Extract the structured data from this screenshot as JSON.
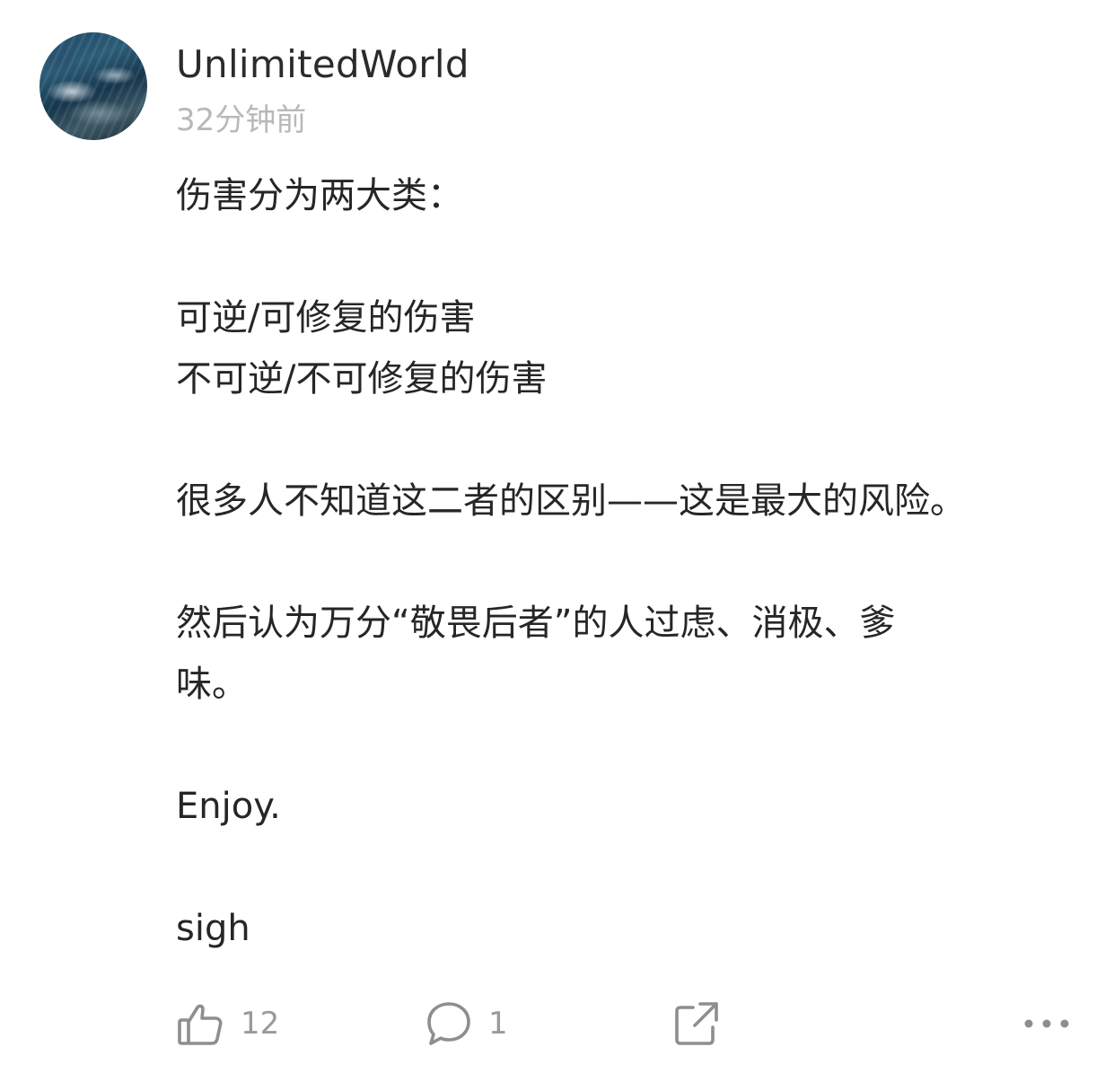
{
  "post": {
    "author": "UnlimitedWorld",
    "timestamp": "32分钟前",
    "paragraphs": [
      "伤害分为两大类：",
      "",
      "可逆/可修复的伤害",
      "不可逆/不可修复的伤害",
      "",
      "很多人不知道这二者的区别——这是最大的风险。",
      "",
      "然后认为万分“敬畏后者”的人过虑、消极、爹",
      "味。",
      "",
      "Enjoy.",
      "",
      "sigh"
    ]
  },
  "actions": {
    "like_icon": "thumbs-up-icon",
    "like_count": "12",
    "comment_icon": "comment-bubble-icon",
    "comment_count": "1",
    "share_icon": "share-icon",
    "more_icon": "more-dots-icon"
  },
  "colors": {
    "text": "#262626",
    "muted": "#b8b8b8",
    "icon": "#8e8e8e"
  }
}
